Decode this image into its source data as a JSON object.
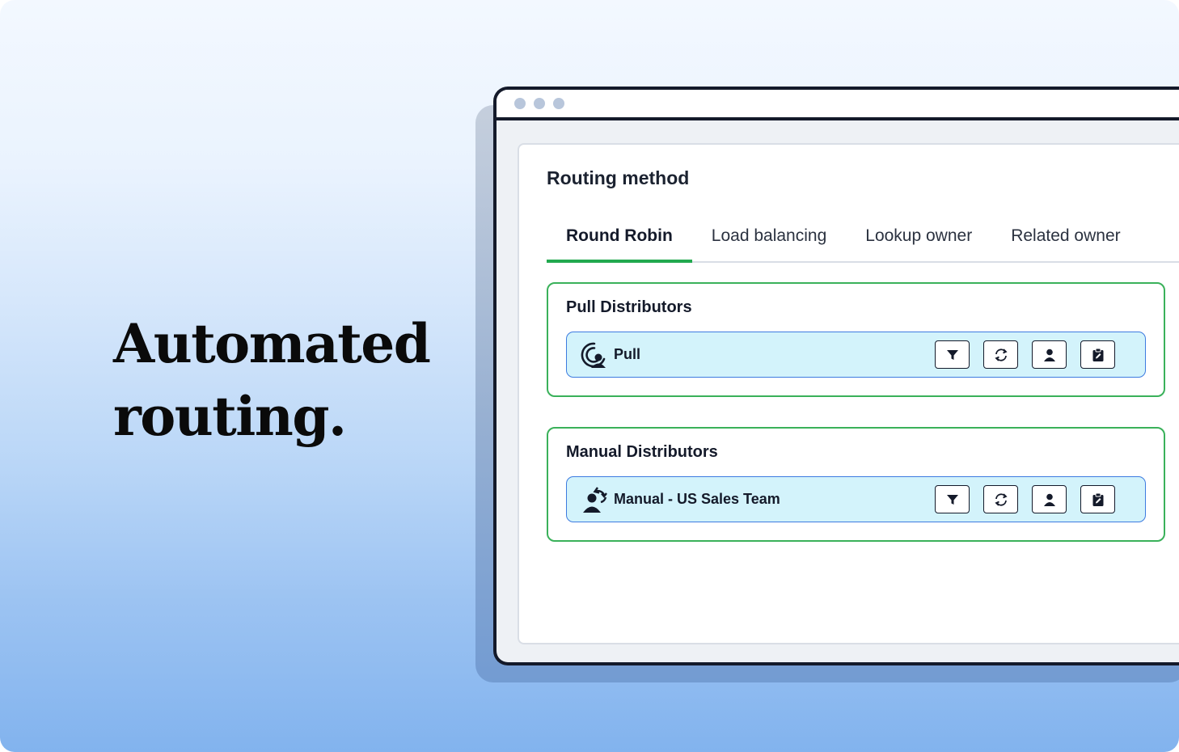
{
  "headline": {
    "line1": "Automated",
    "line2": "routing."
  },
  "routing": {
    "title": "Routing method",
    "tabs": [
      {
        "label": "Round Robin",
        "active": true
      },
      {
        "label": "Load balancing",
        "active": false
      },
      {
        "label": "Lookup owner",
        "active": false
      },
      {
        "label": "Related owner",
        "active": false
      }
    ],
    "groups": [
      {
        "title": "Pull Distributors",
        "row": {
          "label": "Pull",
          "icon": "radar-person-icon"
        }
      },
      {
        "title": "Manual Distributors",
        "row": {
          "label": "Manual - US Sales Team",
          "icon": "person-rotate-icon"
        }
      }
    ],
    "row_actions": [
      "filter-icon",
      "refresh-icon",
      "user-icon",
      "clipboard-edit-icon"
    ]
  },
  "colors": {
    "accent_green": "#22a94f",
    "row_fill": "#d3f3fb",
    "row_border": "#3d7be0",
    "ink": "#141a2a"
  }
}
